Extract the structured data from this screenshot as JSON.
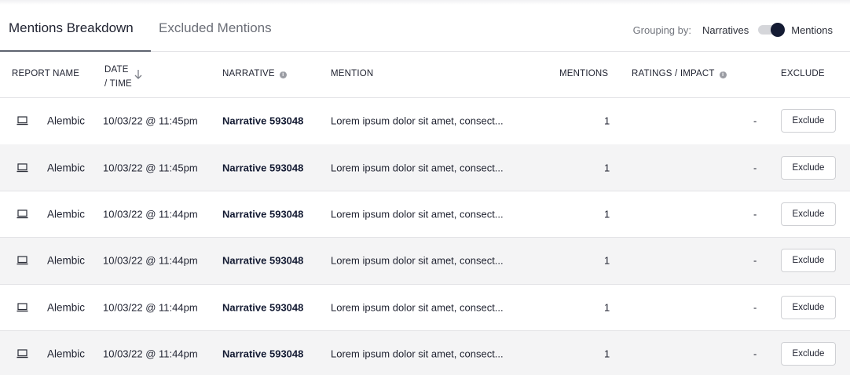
{
  "tabs": {
    "active": "Mentions Breakdown",
    "inactive": "Excluded Mentions"
  },
  "grouping": {
    "label": "Grouping by:",
    "option_left": "Narratives",
    "option_right": "Mentions",
    "selected": "Mentions"
  },
  "columns": {
    "report_name": "REPORT NAME",
    "date_line1": "DATE",
    "date_line2": "/ TIME",
    "narrative": "NARRATIVE",
    "mention": "MENTION",
    "mentions": "MENTIONS",
    "ratings": "RATINGS / IMPACT",
    "exclude": "EXCLUDE"
  },
  "icons": {
    "report": "laptop-icon",
    "sort": "arrow-down-icon",
    "info": "info-icon"
  },
  "colors": {
    "toggle_knob": "#141b33",
    "row_alt": "#f4f4f5"
  },
  "rows": [
    {
      "report": "Alembic",
      "date": "10/03/22 @ 11:45pm",
      "narrative": "Narrative 593048",
      "mention": "Lorem ipsum dolor sit amet, consect...",
      "count": "1",
      "impact": "-",
      "action": "Exclude"
    },
    {
      "report": "Alembic",
      "date": "10/03/22 @ 11:45pm",
      "narrative": "Narrative 593048",
      "mention": "Lorem ipsum dolor sit amet, consect...",
      "count": "1",
      "impact": "-",
      "action": "Exclude"
    },
    {
      "report": "Alembic",
      "date": "10/03/22 @ 11:44pm",
      "narrative": "Narrative 593048",
      "mention": "Lorem ipsum dolor sit amet, consect...",
      "count": "1",
      "impact": "-",
      "action": "Exclude"
    },
    {
      "report": "Alembic",
      "date": "10/03/22 @ 11:44pm",
      "narrative": "Narrative 593048",
      "mention": "Lorem ipsum dolor sit amet, consect...",
      "count": "1",
      "impact": "-",
      "action": "Exclude"
    },
    {
      "report": "Alembic",
      "date": "10/03/22 @ 11:44pm",
      "narrative": "Narrative 593048",
      "mention": "Lorem ipsum dolor sit amet, consect...",
      "count": "1",
      "impact": "-",
      "action": "Exclude"
    },
    {
      "report": "Alembic",
      "date": "10/03/22 @ 11:44pm",
      "narrative": "Narrative 593048",
      "mention": "Lorem ipsum dolor sit amet, consect...",
      "count": "1",
      "impact": "-",
      "action": "Exclude"
    }
  ]
}
